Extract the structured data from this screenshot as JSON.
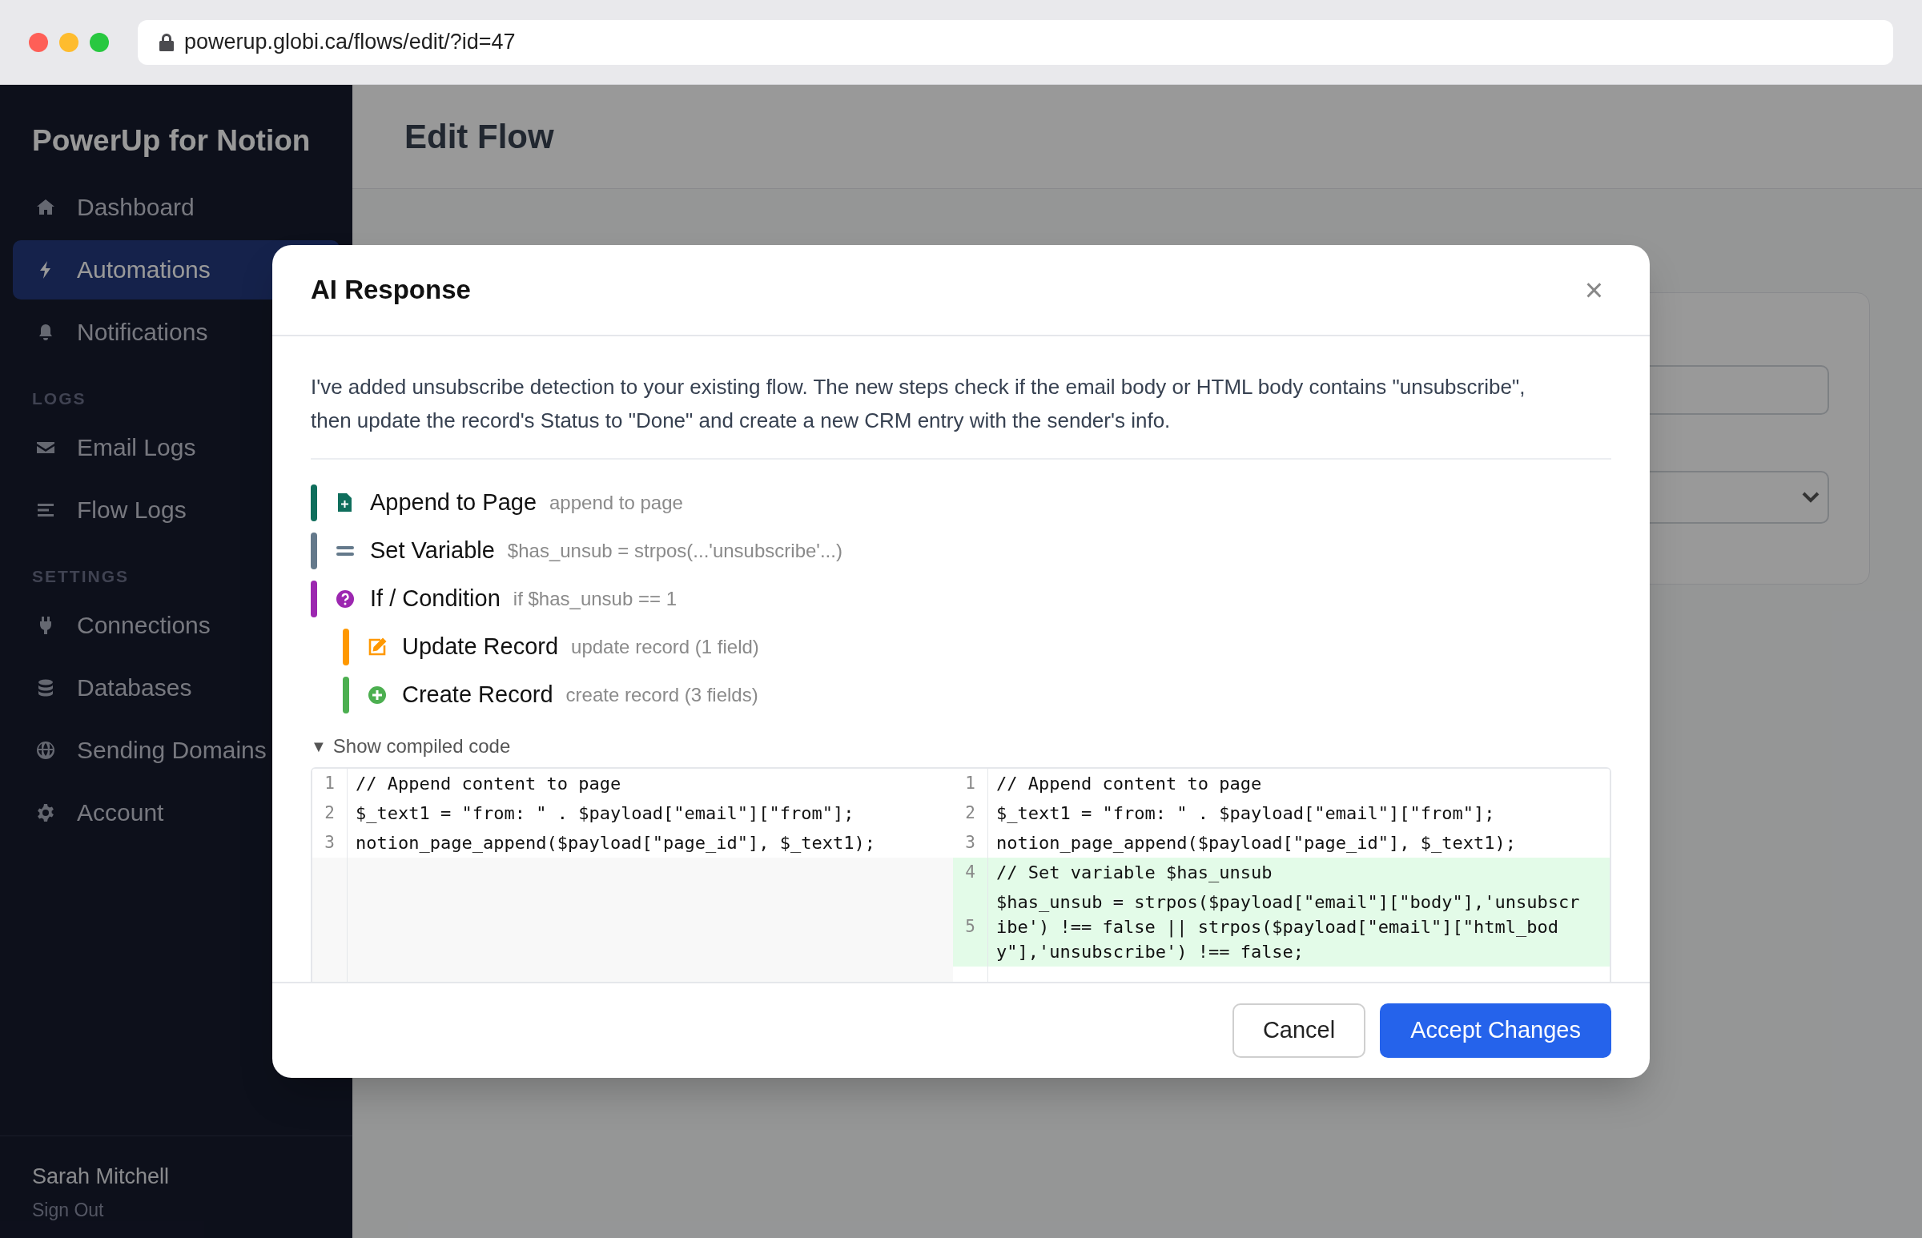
{
  "browser": {
    "url": "powerup.globi.ca/flows/edit/?id=47"
  },
  "sidebar": {
    "title": "PowerUp for Notion",
    "sections": [
      {
        "items": [
          {
            "label": "Dashboard",
            "selected": false
          },
          {
            "label": "Automations",
            "selected": true
          },
          {
            "label": "Notifications",
            "selected": false
          }
        ]
      },
      {
        "heading": "LOGS",
        "items": [
          {
            "label": "Email Logs",
            "selected": false
          },
          {
            "label": "Flow Logs",
            "selected": false
          }
        ]
      },
      {
        "heading": "SETTINGS",
        "items": [
          {
            "label": "Connections",
            "selected": false
          },
          {
            "label": "Databases",
            "selected": false
          },
          {
            "label": "Sending Domains",
            "selected": false
          },
          {
            "label": "Account",
            "selected": false
          }
        ]
      }
    ],
    "user": {
      "name": "Sarah Mitchell",
      "action": "Sign Out"
    }
  },
  "main": {
    "title": "Edit Flow"
  },
  "modal": {
    "title": "AI Response",
    "close": "×",
    "message": "I've added unsubscribe detection to your existing flow. The new steps check if the email body or HTML body contains \"unsubscribe\", then update the record's Status to \"Done\" and create a new CRM entry with the sender's info.",
    "steps": [
      {
        "title": "Append to Page",
        "detail": "append to page",
        "color": "#0f6e5c"
      },
      {
        "title": "Set Variable",
        "detail": "$has_unsub = strpos(...'unsubscribe'...)",
        "color": "#64798b"
      },
      {
        "title": "If / Condition",
        "detail": "if $has_unsub == 1",
        "color": "#9c27b0",
        "children": [
          {
            "title": "Update Record",
            "detail": "update record (1 field)",
            "color": "#ff9800"
          },
          {
            "title": "Create Record",
            "detail": "create record (3 fields)",
            "color": "#4caf50"
          }
        ]
      }
    ],
    "code_toggle": {
      "icon": "▼",
      "label": "Show compiled code",
      "expanded": true
    },
    "code": {
      "left": [
        {
          "number": "1",
          "text": "// Append content to page"
        },
        {
          "number": "2",
          "text": "$_text1 = \"from: \" . $payload[\"email\"][\"from\"];"
        },
        {
          "number": "3",
          "text": "notion_page_append($payload[\"page_id\"], $_text1);"
        }
      ],
      "right": [
        {
          "number": "1",
          "text": "// Append content to page",
          "added": false
        },
        {
          "number": "2",
          "text": "$_text1 = \"from: \" . $payload[\"email\"][\"from\"];",
          "added": false
        },
        {
          "number": "3",
          "text": "notion_page_append($payload[\"page_id\"], $_text1);",
          "added": false
        },
        {
          "number": "4",
          "text": "// Set variable $has_unsub",
          "added": true
        },
        {
          "number": "5",
          "text": "$has_unsub = strpos($payload[\"email\"][\"body\"],'unsubscribe') !== false || strpos($payload[\"email\"][\"html_body\"],'unsubscribe') !== false;",
          "added": true
        }
      ]
    },
    "buttons": [
      {
        "label": "Cancel",
        "kind": "secondary"
      },
      {
        "label": "Accept Changes",
        "kind": "primary"
      }
    ]
  }
}
